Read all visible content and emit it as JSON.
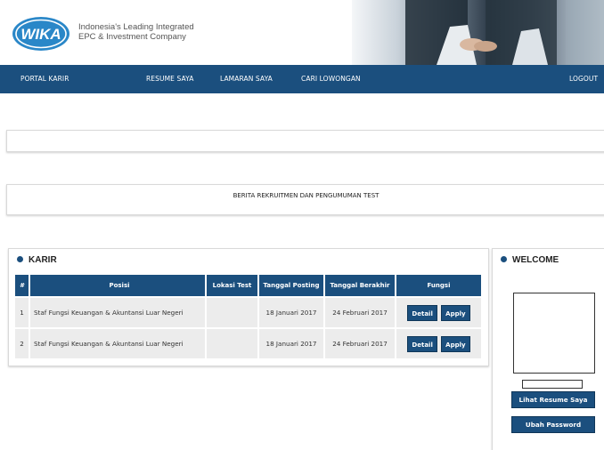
{
  "header": {
    "logo_text": "WIKA",
    "tagline_line1": "Indonesia's Leading Integrated",
    "tagline_line2": "EPC & Investment Company"
  },
  "nav": {
    "portal": "PORTAL KARIR",
    "resume": "RESUME SAYA",
    "lamaran": "LAMARAN SAYA",
    "cari": "CARI LOWONGAN",
    "logout": "LOGOUT"
  },
  "berita": {
    "title": "BERITA REKRUITMEN DAN PENGUMUMAN TEST"
  },
  "karir": {
    "title": "KARIR",
    "columns": [
      "#",
      "Posisi",
      "Lokasi Test",
      "Tanggal Posting",
      "Tanggal Berakhir",
      "Fungsi"
    ],
    "rows": [
      {
        "num": "1",
        "posisi": "Staf Fungsi Keuangan & Akuntansi Luar Negeri",
        "lokasi": "",
        "posting": "18 Januari 2017",
        "berakhir": "24 Februari 2017"
      },
      {
        "num": "2",
        "posisi": "Staf Fungsi Keuangan & Akuntansi Luar Negeri",
        "lokasi": "",
        "posting": "18 Januari 2017",
        "berakhir": "24 Februari 2017"
      }
    ],
    "detail_label": "Detail",
    "apply_label": "Apply"
  },
  "welcome": {
    "title": "WELCOME",
    "resume_button": "Lihat Resume Saya",
    "password_button": "Ubah Password"
  },
  "colors": {
    "nav_bg": "#1b4f7e",
    "logo_blue": "#2a87c8"
  }
}
